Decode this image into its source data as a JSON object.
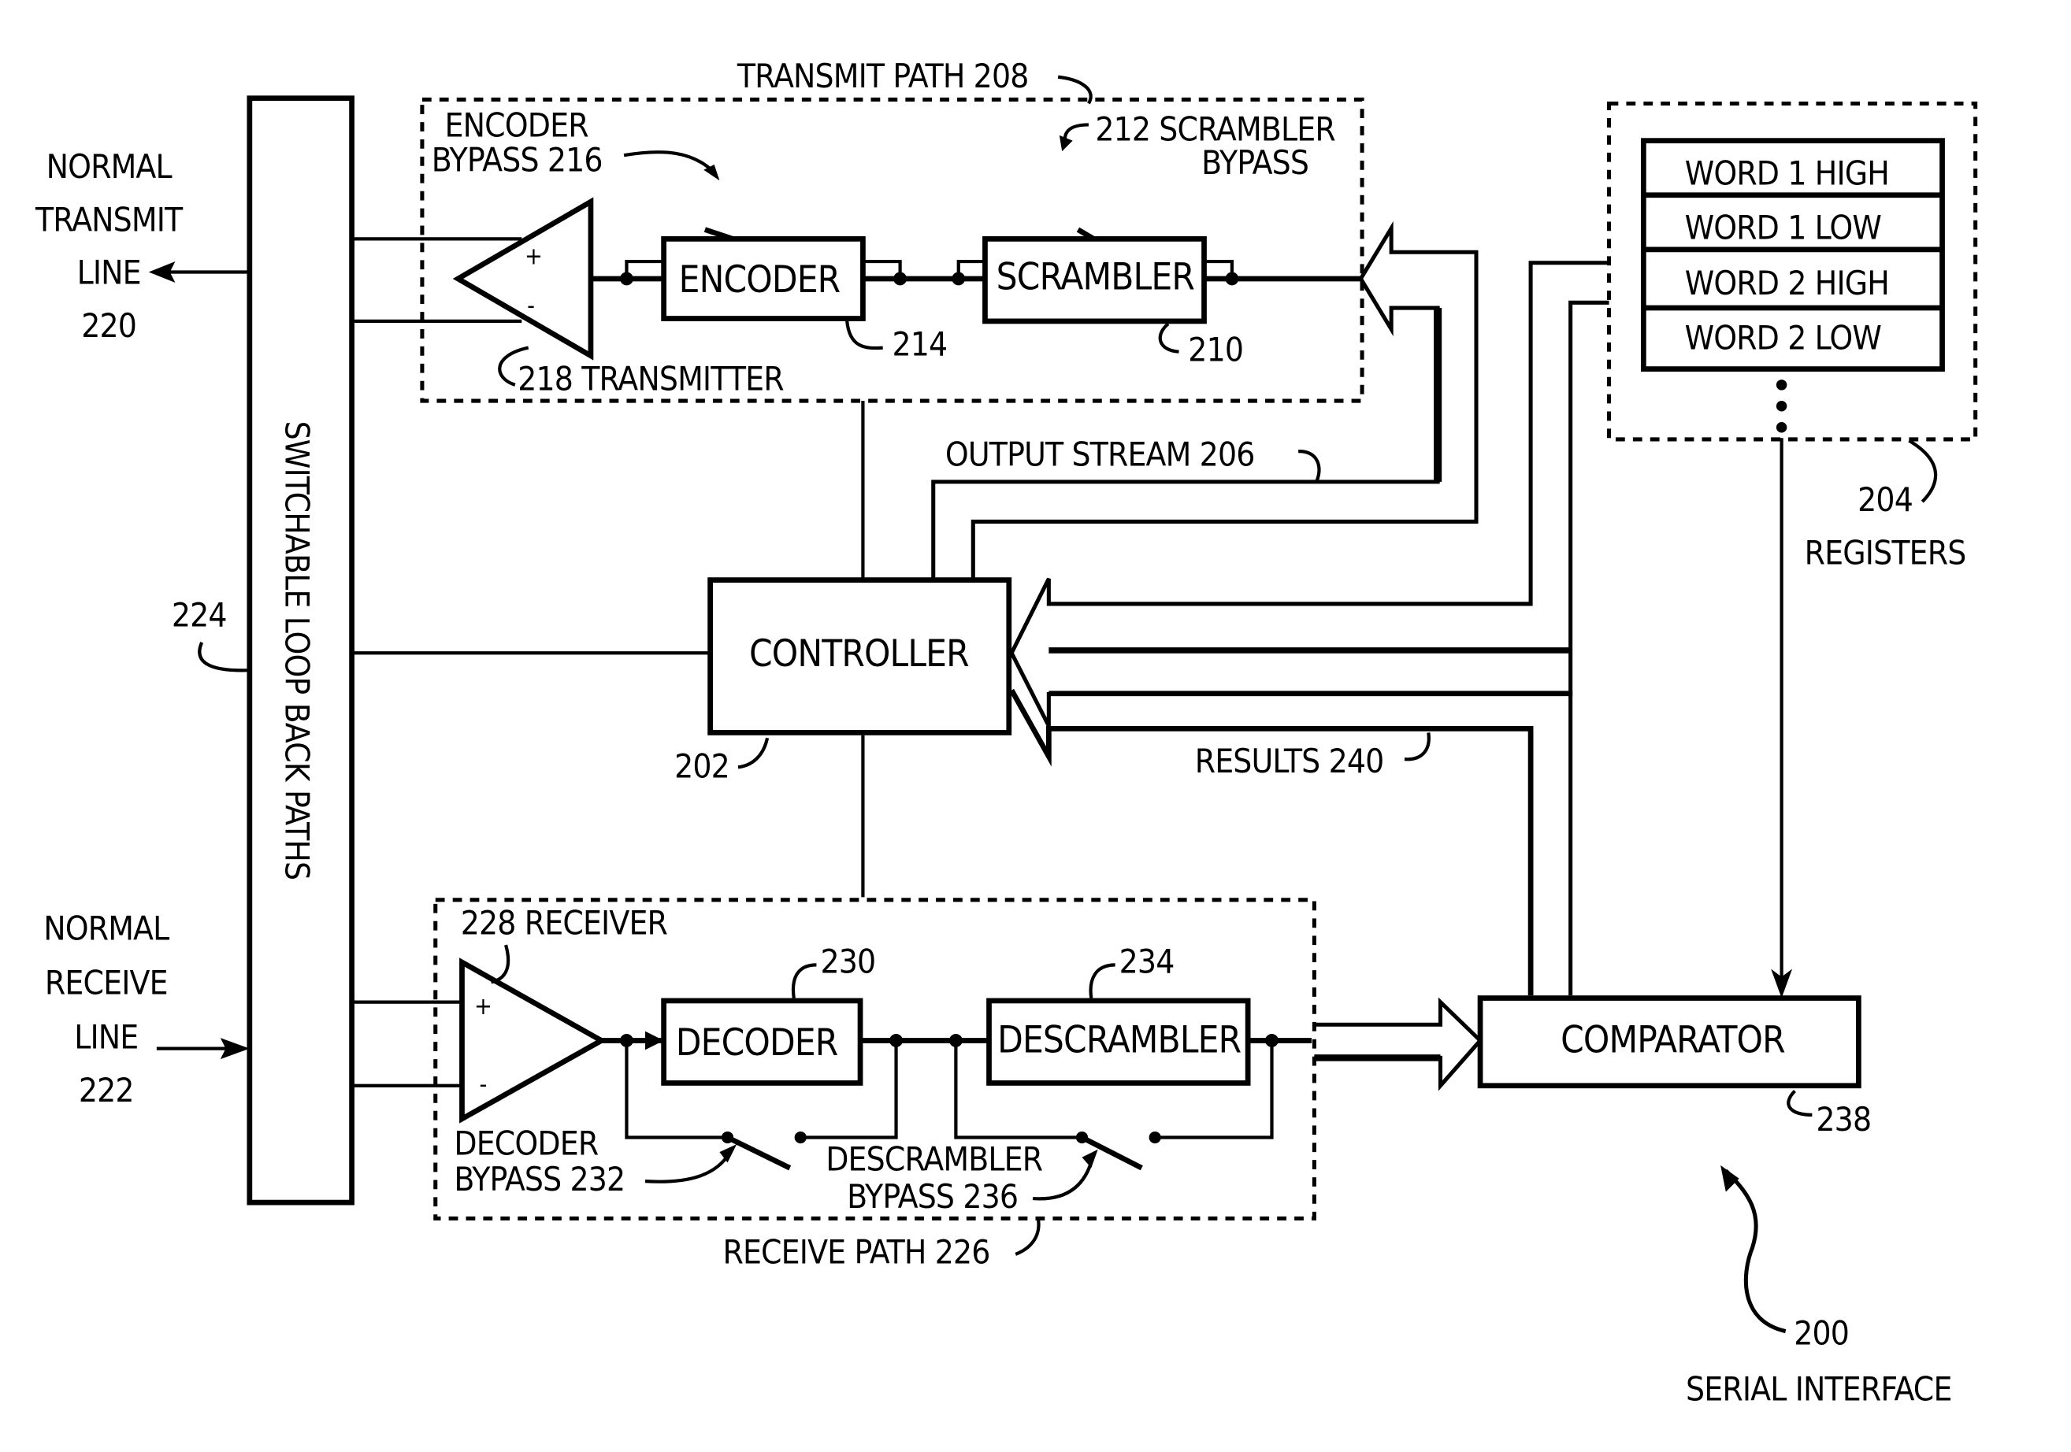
{
  "figure": {
    "title": "Serial Interface",
    "ref_number": "200",
    "ref_label": "SERIAL INTERFACE"
  },
  "left": {
    "transmit_line": [
      "NORMAL",
      "TRANSMIT",
      "LINE",
      "220"
    ],
    "receive_line": [
      "NORMAL",
      "RECEIVE",
      "LINE",
      "222"
    ],
    "loopback_label": "SWITCHABLE LOOP BACK PATHS",
    "loopback_ref": "224"
  },
  "transmit_path": {
    "title": "TRANSMIT PATH 208",
    "encoder_bypass": [
      "ENCODER",
      "BYPASS 216"
    ],
    "scrambler_bypass": [
      "212 SCRAMBLER",
      "BYPASS"
    ],
    "transmitter": "218 TRANSMITTER",
    "encoder": "ENCODER",
    "encoder_ref": "214",
    "scrambler": "SCRAMBLER",
    "scrambler_ref": "210",
    "plus": "+",
    "minus": "-"
  },
  "controller": {
    "label": "CONTROLLER",
    "ref": "202",
    "output_stream": "OUTPUT STREAM 206",
    "results": "RESULTS 240"
  },
  "registers": {
    "rows": [
      "WORD 1 HIGH",
      "WORD 1 LOW",
      "WORD 2 HIGH",
      "WORD 2 LOW"
    ],
    "ref": "204",
    "label": "REGISTERS"
  },
  "receive_path": {
    "title": "RECEIVE PATH 226",
    "receiver": "228 RECEIVER",
    "decoder": "DECODER",
    "decoder_ref": "230",
    "descrambler": "DESCRAMBLER",
    "descrambler_ref": "234",
    "decoder_bypass": [
      "DECODER",
      "BYPASS 232"
    ],
    "descrambler_bypass": [
      "DESCRAMBLER",
      "BYPASS 236"
    ],
    "plus": "+",
    "minus": "-"
  },
  "comparator": {
    "label": "COMPARATOR",
    "ref": "238"
  }
}
